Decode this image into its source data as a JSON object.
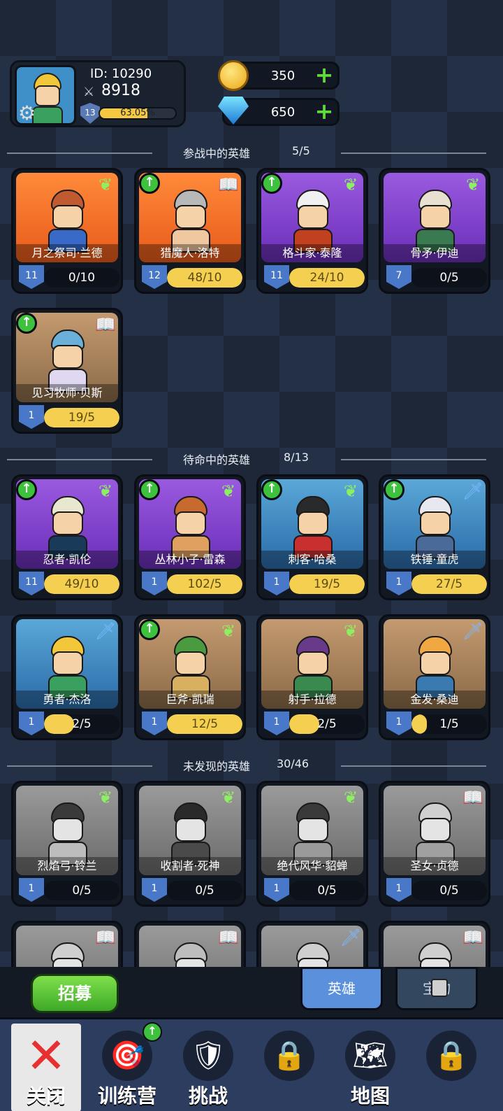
{
  "player": {
    "id_label": "ID: 10290",
    "power": "8918",
    "level": "13",
    "xp_percent_text": "63.05%",
    "xp_fraction": 0.6305
  },
  "currency": {
    "gold": "350",
    "gems": "650"
  },
  "sections": {
    "active": {
      "label": "参战中的英雄",
      "count": "5/5"
    },
    "standby": {
      "label": "待命中的英雄",
      "count": "8/13"
    },
    "undiscovered": {
      "label": "未发现的英雄",
      "count": "30/46"
    }
  },
  "heroes": [
    {
      "name": "月之祭司·兰德",
      "level": "11",
      "progress": "0/10",
      "fill": 0.0,
      "bg": "orange",
      "icon": "wing-icon",
      "upgrade": false,
      "hair": "#c05a30",
      "body": "#3a6ac8"
    },
    {
      "name": "猎魔人·洛特",
      "level": "12",
      "progress": "48/10",
      "fill": 1.0,
      "bg": "orange",
      "icon": "book-icon",
      "upgrade": true,
      "hair": "#b8b8b8",
      "body": "#f0c8a0"
    },
    {
      "name": "格斗家·泰隆",
      "level": "11",
      "progress": "24/10",
      "fill": 1.0,
      "bg": "purple",
      "icon": "wing-icon",
      "upgrade": true,
      "hair": "#f0f0f0",
      "body": "#c04020"
    },
    {
      "name": "骨矛·伊迪",
      "level": "7",
      "progress": "0/5",
      "fill": 0.0,
      "bg": "purple",
      "icon": "wing-icon",
      "upgrade": false,
      "hair": "#e8e0d0",
      "body": "#3a7a50"
    },
    {
      "name": "见习牧师·贝斯",
      "level": "1",
      "progress": "19/5",
      "fill": 1.0,
      "bg": "tan",
      "icon": "book-icon",
      "upgrade": true,
      "hair": "#6ab0d8",
      "body": "#e0d8f0"
    },
    {
      "name": "忍者·凯伦",
      "level": "11",
      "progress": "49/10",
      "fill": 1.0,
      "bg": "purple",
      "icon": "wing-icon",
      "upgrade": true,
      "hair": "#e8e8d0",
      "body": "#1a3a5a"
    },
    {
      "name": "丛林小子·雷森",
      "level": "1",
      "progress": "102/5",
      "fill": 1.0,
      "bg": "purple",
      "icon": "wing-icon",
      "upgrade": true,
      "hair": "#c86a30",
      "body": "#e0a060"
    },
    {
      "name": "刺客·哈桑",
      "level": "1",
      "progress": "19/5",
      "fill": 1.0,
      "bg": "blue",
      "icon": "wing-icon",
      "upgrade": true,
      "hair": "#2a2a2a",
      "body": "#c83030"
    },
    {
      "name": "铁锤·童虎",
      "level": "1",
      "progress": "27/5",
      "fill": 1.0,
      "bg": "blue",
      "icon": "sword-icon",
      "upgrade": true,
      "hair": "#e8e8f0",
      "body": "#4a6a9a"
    },
    {
      "name": "勇者·杰洛",
      "level": "1",
      "progress": "2/5",
      "fill": 0.4,
      "bg": "blue",
      "icon": "sword-icon",
      "upgrade": false,
      "hair": "#f2c83a",
      "body": "#3aa060"
    },
    {
      "name": "巨斧·凯瑞",
      "level": "1",
      "progress": "12/5",
      "fill": 1.0,
      "bg": "tan",
      "icon": "wing-icon",
      "upgrade": true,
      "hair": "#4a9a40",
      "body": "#d8b060"
    },
    {
      "name": "射手·拉德",
      "level": "1",
      "progress": "2/5",
      "fill": 0.4,
      "bg": "tan",
      "icon": "wing-icon",
      "upgrade": false,
      "hair": "#6a3a8a",
      "body": "#3a8a50"
    },
    {
      "name": "金发·桑迪",
      "level": "1",
      "progress": "1/5",
      "fill": 0.2,
      "bg": "tan",
      "icon": "sword-icon",
      "upgrade": false,
      "hair": "#f2a840",
      "body": "#3a7ab0"
    },
    {
      "name": "烈焰弓·铃兰",
      "level": "1",
      "progress": "0/5",
      "fill": 0.0,
      "bg": "gray",
      "icon": "wing-icon",
      "upgrade": false,
      "hair": "#3a3a3a",
      "body": "#bdbdbd"
    },
    {
      "name": "收割者·死神",
      "level": "1",
      "progress": "0/5",
      "fill": 0.0,
      "bg": "gray",
      "icon": "wing-icon",
      "upgrade": false,
      "hair": "#2a2a2a",
      "body": "#4a4a4a"
    },
    {
      "name": "绝代风华·貂蝉",
      "level": "1",
      "progress": "0/5",
      "fill": 0.0,
      "bg": "gray",
      "icon": "wing-icon",
      "upgrade": false,
      "hair": "#3a3a3a",
      "body": "#9a9a9a"
    },
    {
      "name": "圣女·贞德",
      "level": "1",
      "progress": "0/5",
      "fill": 0.0,
      "bg": "gray",
      "icon": "book-icon",
      "upgrade": false,
      "hair": "#d0d0d0",
      "body": "#a0a0a0"
    },
    {
      "name": "",
      "level": "",
      "progress": "",
      "fill": 0.0,
      "bg": "gray",
      "icon": "book-icon",
      "upgrade": false,
      "hair": "#cfcfcf",
      "body": "#9a9a9a"
    },
    {
      "name": "",
      "level": "",
      "progress": "",
      "fill": 0.0,
      "bg": "gray",
      "icon": "book-icon",
      "upgrade": false,
      "hair": "#bdbdbd",
      "body": "#9a9a9a"
    },
    {
      "name": "",
      "level": "",
      "progress": "",
      "fill": 0.0,
      "bg": "gray",
      "icon": "sword-icon",
      "upgrade": false,
      "hair": "#cfcfcf",
      "body": "#9a9a9a"
    },
    {
      "name": "",
      "level": "",
      "progress": "",
      "fill": 0.0,
      "bg": "gray",
      "icon": "book-icon",
      "upgrade": false,
      "hair": "#cfcfcf",
      "body": "#9a9a9a"
    }
  ],
  "actions": {
    "recruit": "招募",
    "tab_heroes": "英雄",
    "tab_locked": "宝物"
  },
  "nav": [
    {
      "label": "关闭",
      "icon": "close-icon"
    },
    {
      "label": "训练营",
      "icon": "training-icon"
    },
    {
      "label": "挑战",
      "icon": "sword-icon"
    },
    {
      "label": "",
      "icon": "lock-icon"
    },
    {
      "label": "地图",
      "icon": "map-icon"
    },
    {
      "label": "",
      "icon": "lock-icon"
    }
  ]
}
